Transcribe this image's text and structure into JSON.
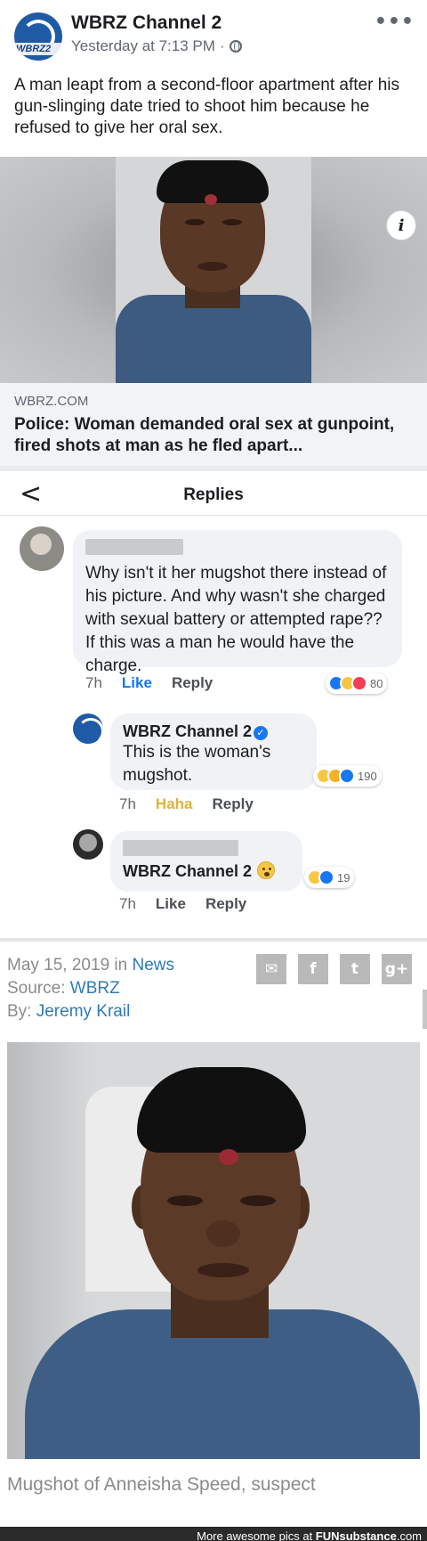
{
  "post": {
    "page_name": "WBRZ Channel 2",
    "timestamp": "Yesterday at 7:13 PM",
    "separator": "·",
    "logo_text": "WBRZ2",
    "more_glyph": "•••",
    "text": "A man leapt from a second-floor apartment after his gun-slinging date tried to shoot him because he refused to give her oral sex.",
    "link": {
      "info_glyph": "i",
      "domain": "WBRZ.COM",
      "title": "Police: Woman demanded oral sex at gunpoint, fired shots at man as he fled apart..."
    }
  },
  "replies": {
    "back_glyph": "<",
    "title": "Replies",
    "comments": [
      {
        "text": "Why isn't it her mugshot there instead of his picture. And why wasn't she charged with sexual battery or attempted rape?? If this was a man he would have the charge.",
        "time": "7h",
        "like_label": "Like",
        "reply_label": "Reply",
        "reaction_count": "80",
        "reactions": [
          "like",
          "haha",
          "love"
        ]
      },
      {
        "author": "WBRZ Channel 2",
        "verified_glyph": "✓",
        "text": "This is the woman's mugshot.",
        "time": "7h",
        "like_label": "Haha",
        "reply_label": "Reply",
        "reaction_count": "190",
        "reactions": [
          "haha",
          "wow",
          "like"
        ]
      },
      {
        "text": "WBRZ Channel 2",
        "time": "7h",
        "like_label": "Like",
        "reply_label": "Reply",
        "reaction_count": "19",
        "reactions": [
          "haha",
          "like"
        ]
      }
    ]
  },
  "article": {
    "date": "May 15, 2019",
    "in_label": "in",
    "category": "News",
    "source_label": "Source:",
    "source": "WBRZ",
    "by_label": "By:",
    "author": "Jeremy Krail",
    "share_icons": [
      "✉",
      "f",
      "t",
      "g+"
    ],
    "caption": "Mugshot of Anneisha Speed, suspect"
  },
  "footer": {
    "prefix": "More awesome pics at ",
    "brand": "FUNsubstance",
    "suffix": ".com"
  },
  "colors": {
    "fb_blue": "#1877f2",
    "wbrz_blue": "#1e5aa6",
    "link_color": "#2e7bb8",
    "haha_yellow": "#e2b23a"
  }
}
